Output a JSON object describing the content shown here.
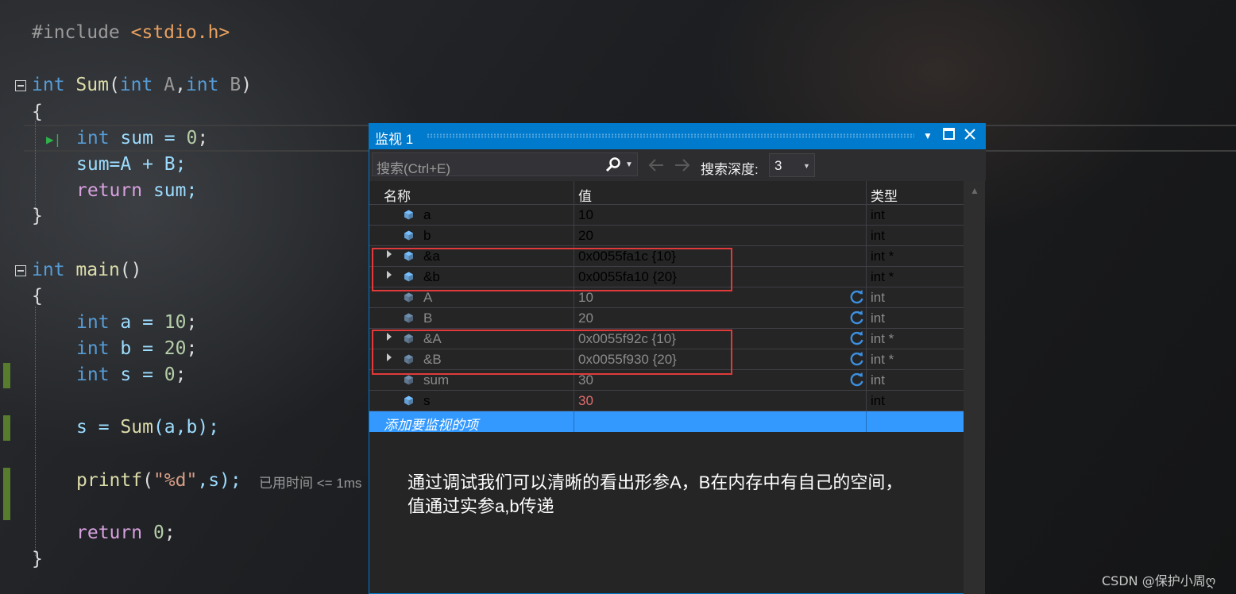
{
  "editor": {
    "lines": {
      "include_kw": "#include",
      "include_file": "<stdio.h>",
      "sum_kw": "int",
      "sum_name": "Sum",
      "sum_params_a_kw": "int",
      "sum_param_a": "A",
      "sum_params_b_kw": "int",
      "sum_param_b": "B",
      "brace_open": "{",
      "brace_close": "}",
      "l_sum_decl_kw": "int",
      "l_sum_decl_rest": "sum = ",
      "l_sum_decl_num": "0",
      "l_sum_assign": "sum=A + B;",
      "l_return_kw": "return",
      "l_return_rest": "sum;",
      "main_kw": "int",
      "main_name": "main",
      "main_paren": "()",
      "a_kw": "int",
      "a_rest": "a = ",
      "a_num": "10",
      "b_kw": "int",
      "b_rest": "b = ",
      "b_num": "20",
      "s_kw": "int",
      "s_rest": "s = ",
      "s_num": "0",
      "call_s": "s = ",
      "call_fn": "Sum",
      "call_args": "(a,b);",
      "printf_fn": "printf",
      "printf_open": "(",
      "printf_str": "\"%d\"",
      "printf_rest": ",s);",
      "ret0_kw": "return",
      "ret0_num": "0",
      "ret0_semi": ";"
    },
    "elapsed": "已用时间 <= 1ms"
  },
  "watch": {
    "title": "监视 1",
    "search_placeholder": "搜索(Ctrl+E)",
    "depth_label": "搜索深度:",
    "depth_value": "3",
    "columns": {
      "name": "名称",
      "value": "值",
      "type": "类型"
    },
    "rows": [
      {
        "name": "a",
        "value": "10",
        "type": "int"
      },
      {
        "name": "b",
        "value": "20",
        "type": "int"
      },
      {
        "name": "&a",
        "value": "0x0055fa1c {10}",
        "type": "int *"
      },
      {
        "name": "&b",
        "value": "0x0055fa10 {20}",
        "type": "int *"
      },
      {
        "name": "A",
        "value": "10",
        "type": "int"
      },
      {
        "name": "B",
        "value": "20",
        "type": "int"
      },
      {
        "name": "&A",
        "value": "0x0055f92c {10}",
        "type": "int *"
      },
      {
        "name": "&B",
        "value": "0x0055f930 {20}",
        "type": "int *"
      },
      {
        "name": "sum",
        "value": "30",
        "type": "int"
      },
      {
        "name": "s",
        "value": "30",
        "type": "int"
      }
    ],
    "add_item": "添加要监视的项",
    "note_line1": "通过调试我们可以清晰的看出形参A，B在内存中有自己的空间，",
    "note_line2": "值通过实参a,b传递"
  },
  "watermark": "CSDN @保护小周ღ",
  "colors": {
    "accent": "#007acc",
    "selection": "#3399ff",
    "highlight_box": "#e03a3a",
    "changed_value": "#e06c6c"
  }
}
